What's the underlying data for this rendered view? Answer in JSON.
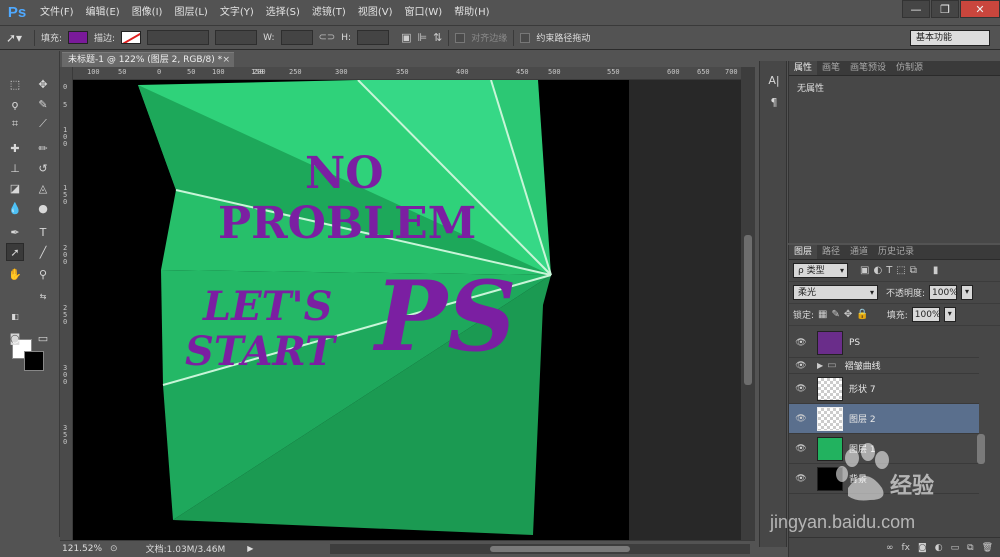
{
  "menubar": {
    "logo": "Ps",
    "items": [
      "文件(F)",
      "编辑(E)",
      "图像(I)",
      "图层(L)",
      "文字(Y)",
      "选择(S)",
      "滤镜(T)",
      "视图(V)",
      "窗口(W)",
      "帮助(H)"
    ],
    "window_controls": [
      "—",
      "❐",
      "✕"
    ]
  },
  "options": {
    "fill_label": "填充:",
    "stroke_label": "描边:",
    "width_label": "W:",
    "height_label": "H:",
    "align_edges": "对齐边缘",
    "constrain_path": "约束路径拖动",
    "workspace": "基本功能"
  },
  "document": {
    "tab_title": "未标题-1 @ 122% (图层 2, RGB/8) *",
    "tab_close": "×"
  },
  "ruler": {
    "h_ticks": [
      "100",
      "50",
      "0",
      "50",
      "100",
      "150",
      "200",
      "250",
      "300",
      "350",
      "400",
      "450",
      "500",
      "550",
      "600",
      "650",
      "700"
    ],
    "v_ticks": [
      "0",
      "5",
      "1 0 0",
      "1 5 0",
      "2 0 0",
      "2 5 0",
      "3 0 0",
      "3 5 0"
    ]
  },
  "artwork": {
    "text_no": "NO",
    "text_problem": "PROBLEM",
    "text_lets": "LET'S",
    "text_start": "START",
    "text_ps": "PS",
    "text_color": "#7b1fa2",
    "green_light": "#2ecc71",
    "green_dark": "#1b9e4b"
  },
  "status": {
    "zoom": "121.52%",
    "doc": "文档:1.03M/3.46M"
  },
  "properties_panel": {
    "tabs": [
      "属性",
      "画笔",
      "画笔预设",
      "仿制源"
    ],
    "empty_text": "无属性"
  },
  "layers_panel": {
    "tabs": [
      "图层",
      "路径",
      "通道",
      "历史记录"
    ],
    "filter_label": "ρ 类型",
    "blend_mode": "柔光",
    "opacity_label": "不透明度:",
    "opacity_value": "100%",
    "lock_label": "锁定:",
    "fill_label": "填充:",
    "fill_value": "100%",
    "layers": [
      {
        "name": "PS",
        "type": "smart"
      },
      {
        "name": "褶皱曲线",
        "type": "group"
      },
      {
        "name": "形状 7",
        "type": "shape"
      },
      {
        "name": "图层 2",
        "type": "pixel",
        "selected": true
      },
      {
        "name": "图层 1",
        "type": "pixel-green"
      },
      {
        "name": "背景",
        "type": "background"
      }
    ],
    "footer_icons": [
      "∞",
      "fx",
      "◙",
      "◐",
      "▭",
      "⧉",
      "🗑"
    ]
  },
  "watermark": {
    "brand_cn": "经验",
    "site": "jingyan.baidu.com"
  }
}
